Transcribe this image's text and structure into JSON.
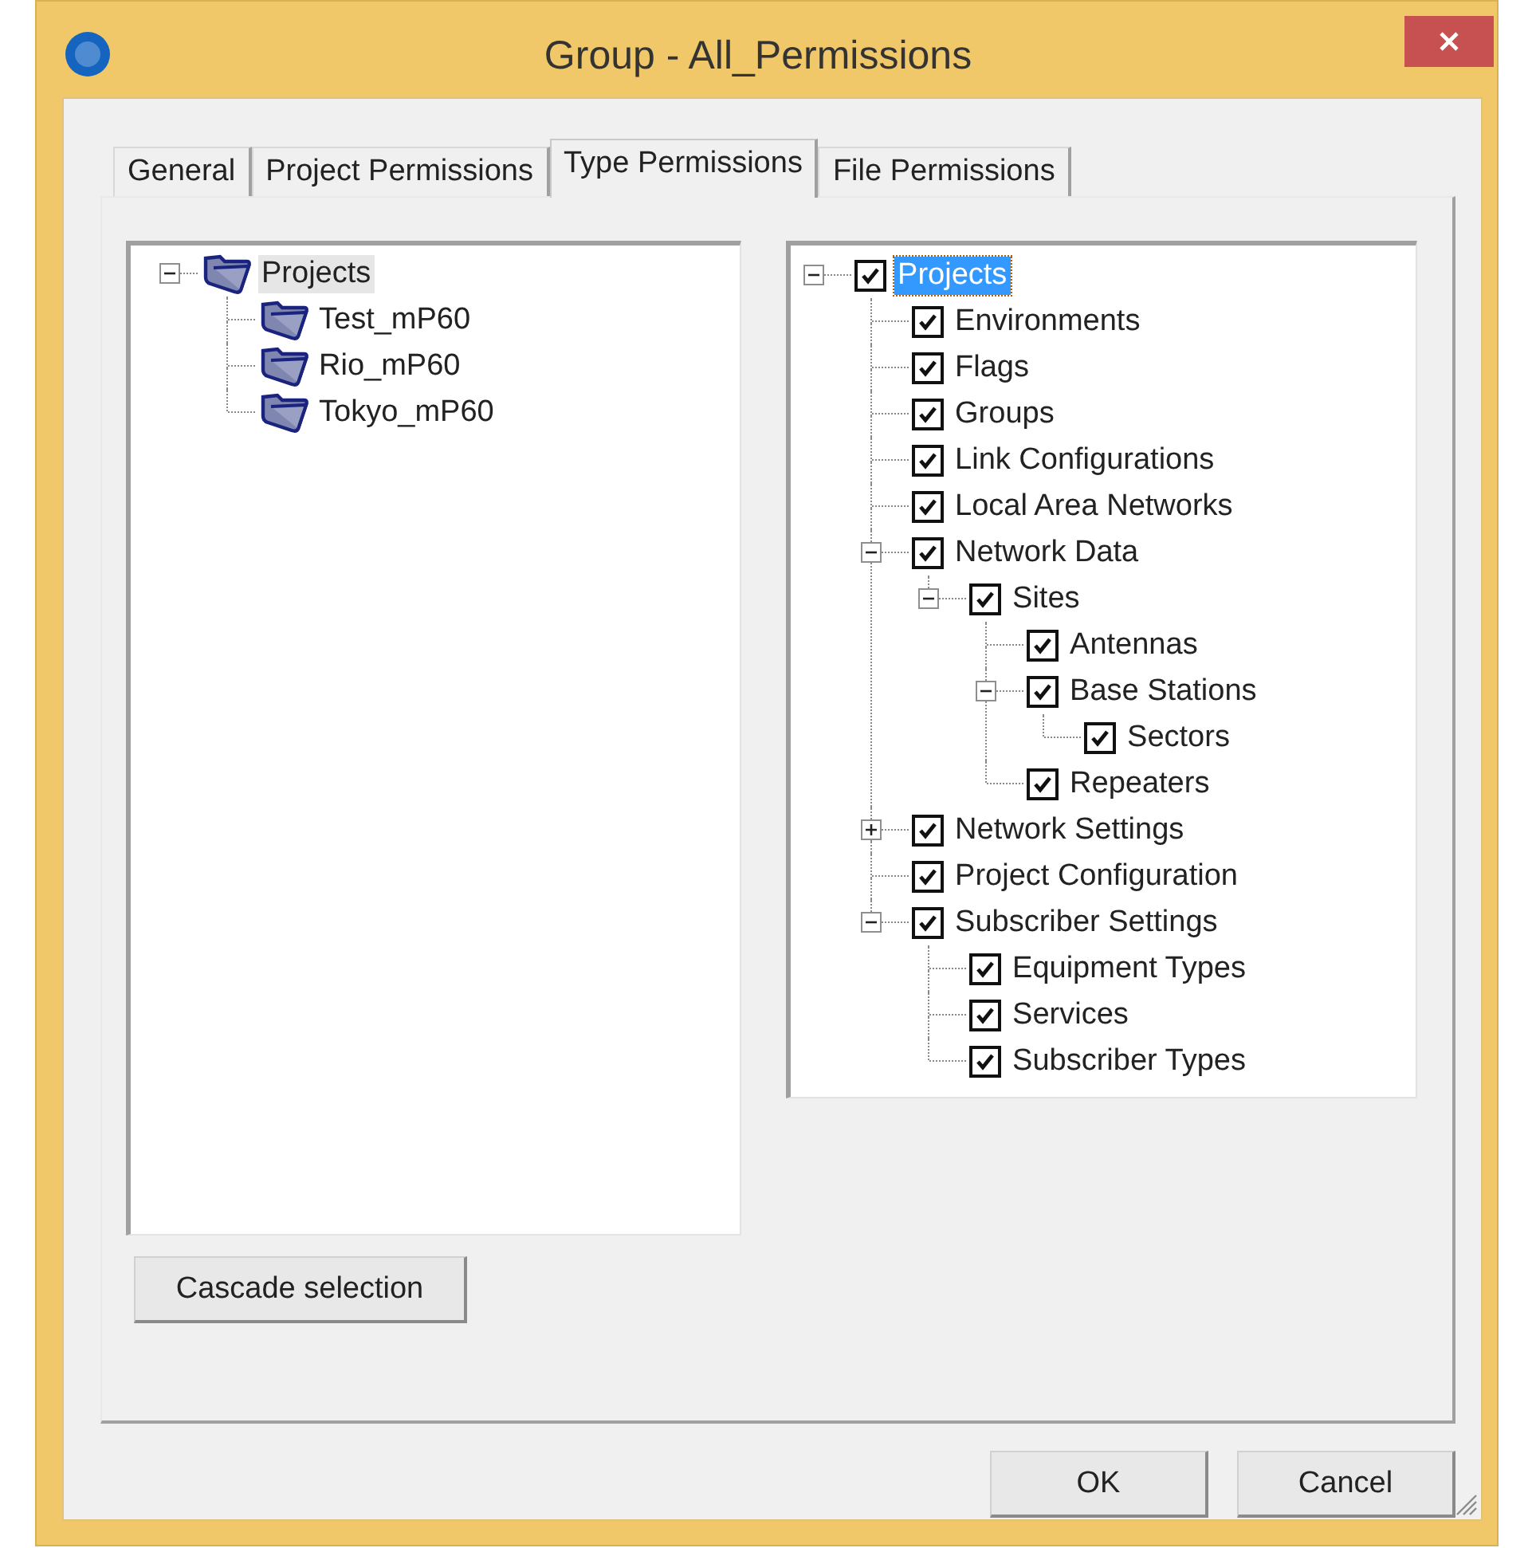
{
  "window": {
    "title": "Group - All_Permissions"
  },
  "tabs": [
    {
      "label": "General",
      "selected": false
    },
    {
      "label": "Project Permissions",
      "selected": false
    },
    {
      "label": "Type Permissions",
      "selected": true
    },
    {
      "label": "File Permissions",
      "selected": false
    }
  ],
  "project_tree": {
    "focused": false,
    "items": [
      {
        "label": "Projects",
        "selected": true,
        "expanded": true,
        "children": [
          {
            "label": "Test_mP60",
            "selected": false
          },
          {
            "label": "Rio_mP60",
            "selected": false
          },
          {
            "label": "Tokyo_mP60",
            "selected": false
          }
        ]
      }
    ]
  },
  "type_tree": {
    "focused": true,
    "items": [
      {
        "label": "Projects",
        "selected": true,
        "checked": true,
        "expanded": true,
        "children": [
          {
            "label": "Environments",
            "selected": false,
            "checked": true
          },
          {
            "label": "Flags",
            "selected": false,
            "checked": true
          },
          {
            "label": "Groups",
            "selected": false,
            "checked": true
          },
          {
            "label": "Link Configurations",
            "selected": false,
            "checked": true
          },
          {
            "label": "Local Area Networks",
            "selected": false,
            "checked": true
          },
          {
            "label": "Network Data",
            "selected": false,
            "checked": true,
            "expanded": true,
            "children": [
              {
                "label": "Sites",
                "selected": false,
                "checked": true,
                "expanded": true,
                "children": [
                  {
                    "label": "Antennas",
                    "selected": false,
                    "checked": true
                  },
                  {
                    "label": "Base Stations",
                    "selected": false,
                    "checked": true,
                    "expanded": true,
                    "children": [
                      {
                        "label": "Sectors",
                        "selected": false,
                        "checked": true
                      }
                    ]
                  },
                  {
                    "label": "Repeaters",
                    "selected": false,
                    "checked": true
                  }
                ]
              }
            ]
          },
          {
            "label": "Network Settings",
            "selected": false,
            "checked": true,
            "expanded": false
          },
          {
            "label": "Project Configuration",
            "selected": false,
            "checked": true
          },
          {
            "label": "Subscriber Settings",
            "selected": false,
            "checked": true,
            "expanded": true,
            "children": [
              {
                "label": "Equipment Types",
                "selected": false,
                "checked": true
              },
              {
                "label": "Services",
                "selected": false,
                "checked": true
              },
              {
                "label": "Subscriber Types",
                "selected": false,
                "checked": true
              }
            ]
          }
        ]
      }
    ]
  },
  "cascade_button": "Cascade selection",
  "buttons": [
    "OK",
    "Cancel"
  ]
}
